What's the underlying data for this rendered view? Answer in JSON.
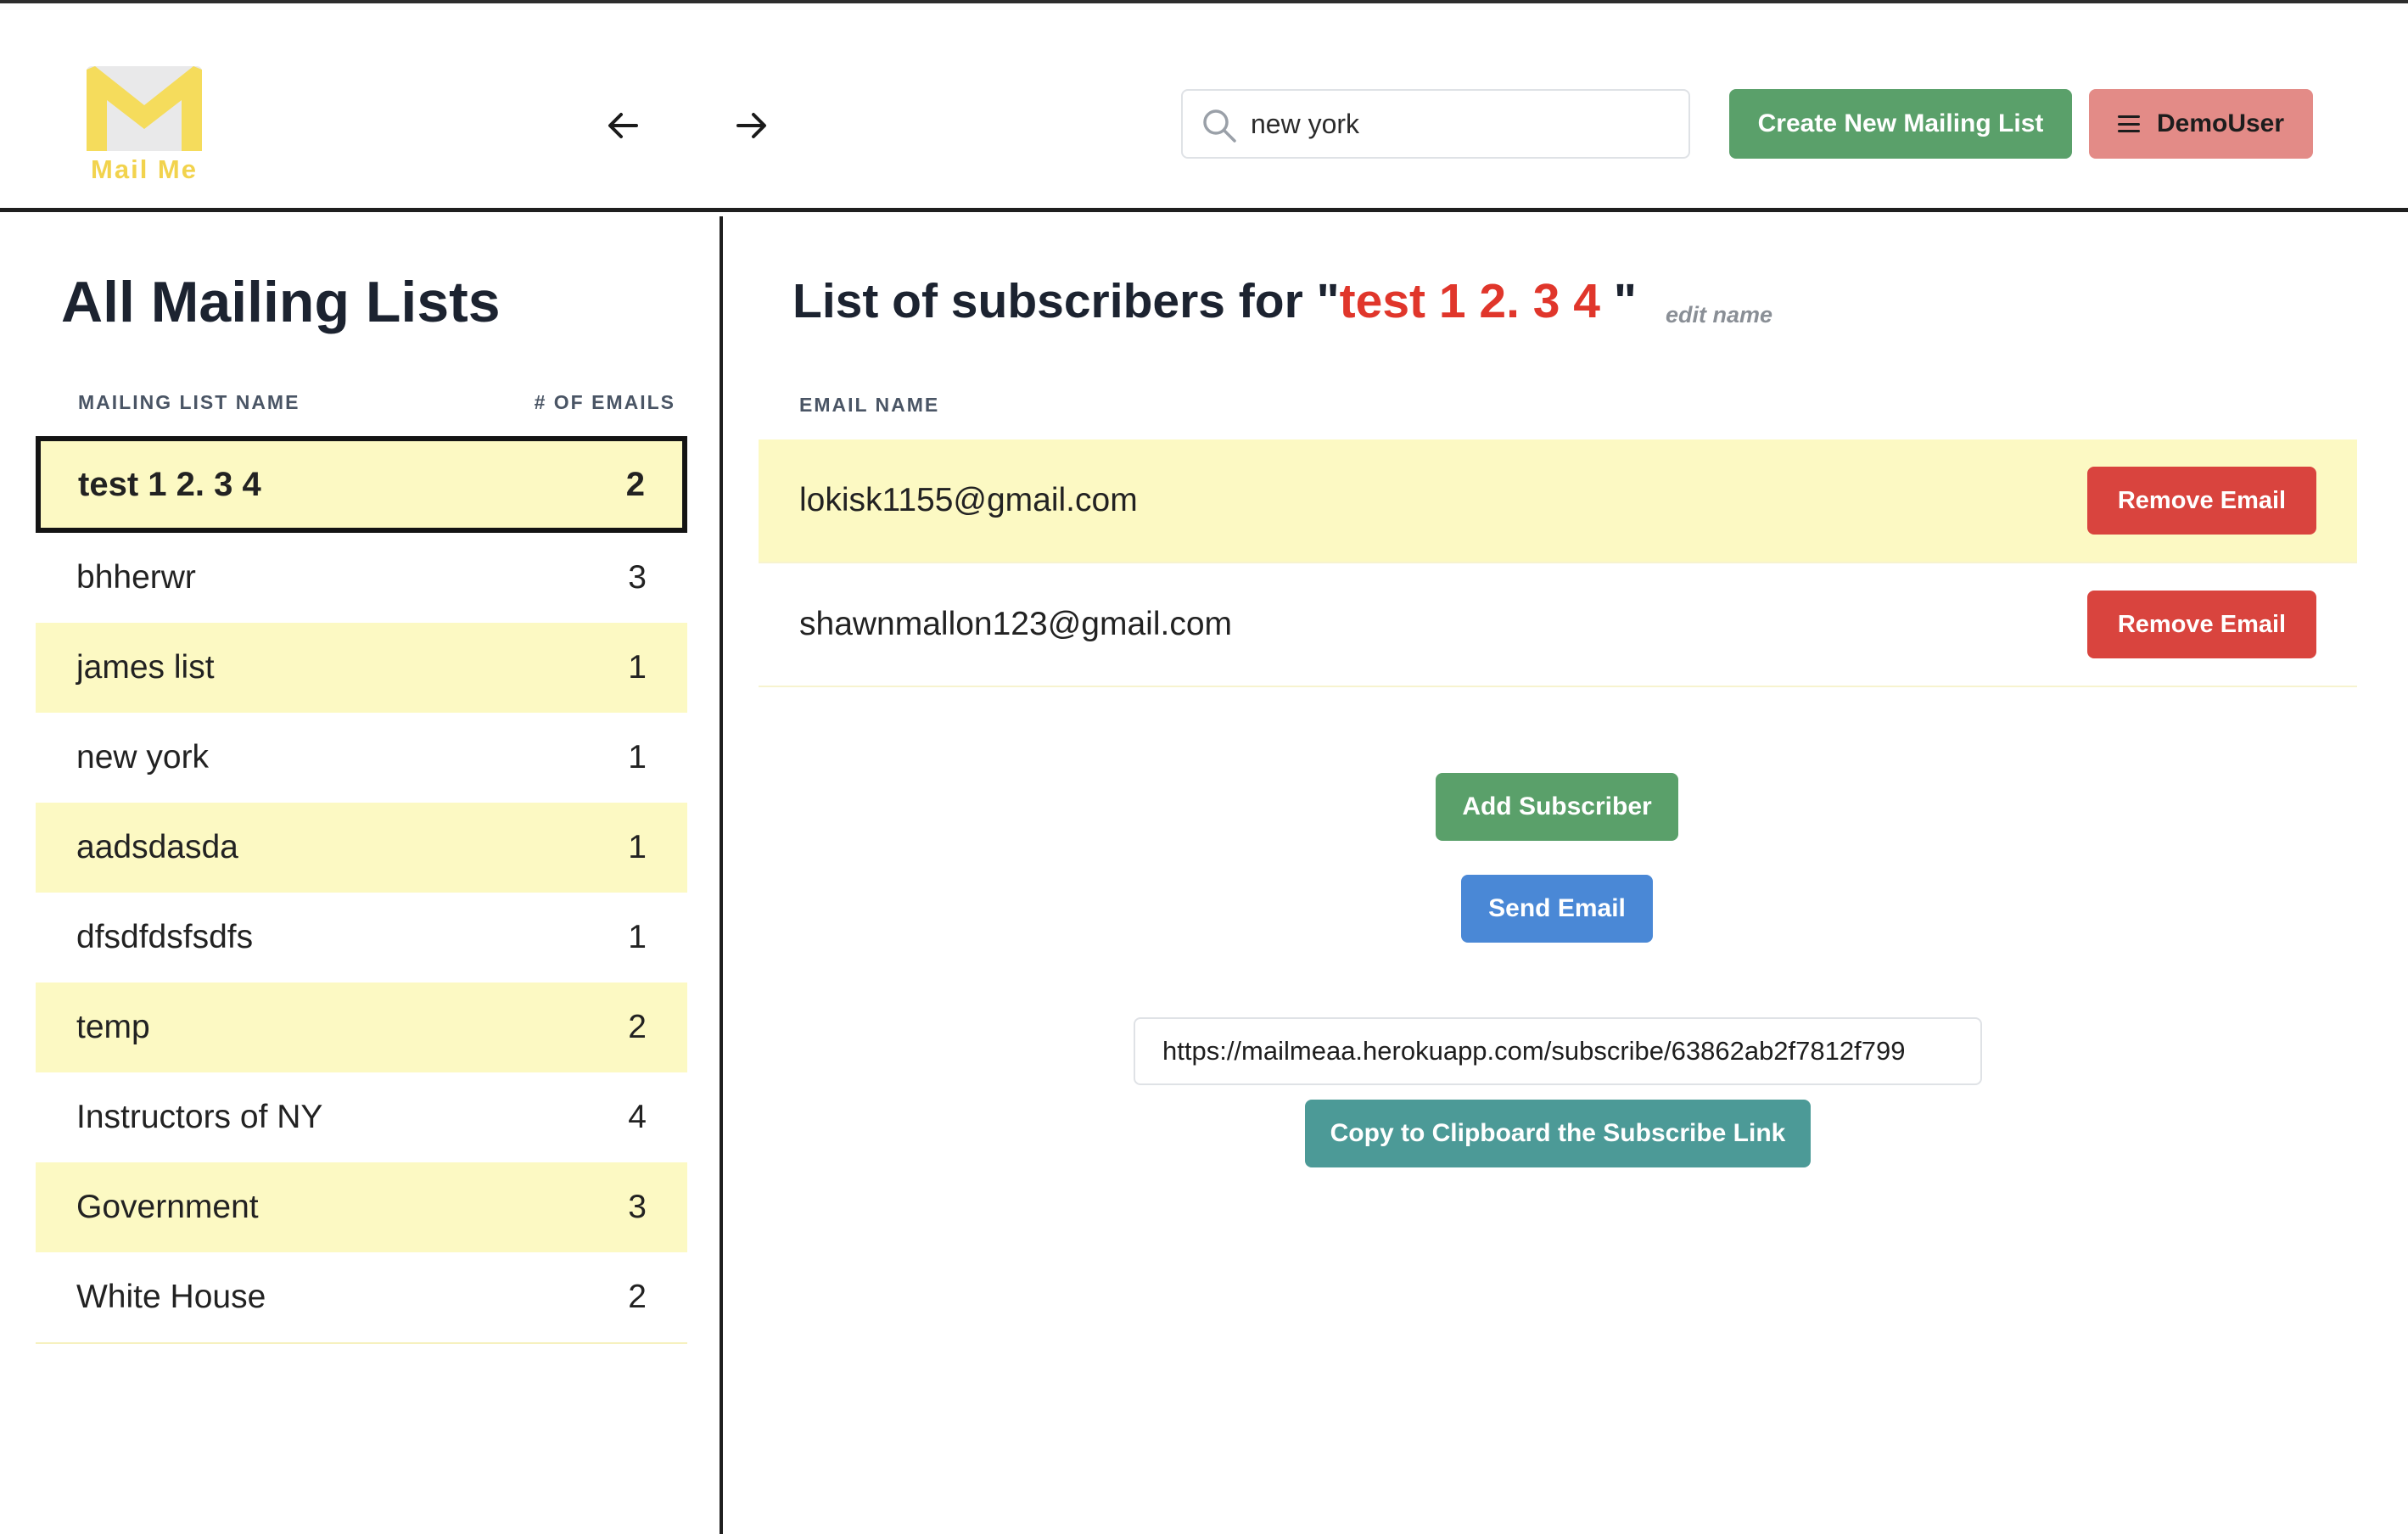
{
  "header": {
    "logo_text": "Mail Me",
    "search": {
      "value": "new york",
      "placeholder": ""
    },
    "create_button": "Create New Mailing List",
    "user_button": "DemoUser"
  },
  "sidebar": {
    "title": "All Mailing Lists",
    "col_name": "MAILING LIST NAME",
    "col_count": "# OF EMAILS",
    "items": [
      {
        "name": "test 1 2. 3 4",
        "count": "2"
      },
      {
        "name": "bhherwr",
        "count": "3"
      },
      {
        "name": "james list",
        "count": "1"
      },
      {
        "name": "new york",
        "count": "1"
      },
      {
        "name": "aadsdasda",
        "count": "1"
      },
      {
        "name": "dfsdfdsfsdfs",
        "count": "1"
      },
      {
        "name": "temp",
        "count": "2"
      },
      {
        "name": "Instructors of NY",
        "count": "4"
      },
      {
        "name": "Government",
        "count": "3"
      },
      {
        "name": "White House",
        "count": "2"
      }
    ]
  },
  "main": {
    "title_prefix": "List of subscribers for \"",
    "list_name": "test 1 2. 3 4",
    "title_suffix": " \"",
    "edit_name": "edit name",
    "email_header": "EMAIL NAME",
    "emails": [
      {
        "email": "lokisk1155@gmail.com",
        "remove_label": "Remove Email"
      },
      {
        "email": "shawnmallon123@gmail.com",
        "remove_label": "Remove Email"
      }
    ],
    "add_subscriber": "Add Subscriber",
    "send_email": "Send Email",
    "subscribe_link": "https://mailmeaa.herokuapp.com/subscribe/63862ab2f7812f799",
    "copy_button": "Copy to Clipboard the Subscribe Link"
  },
  "colors": {
    "accent_green": "#5aa06a",
    "accent_red": "#d9443e",
    "accent_blue": "#4a88d6",
    "accent_teal": "#4c9a97",
    "highlight_yellow": "#fcf9c3",
    "logo_yellow": "#f2d34d"
  }
}
